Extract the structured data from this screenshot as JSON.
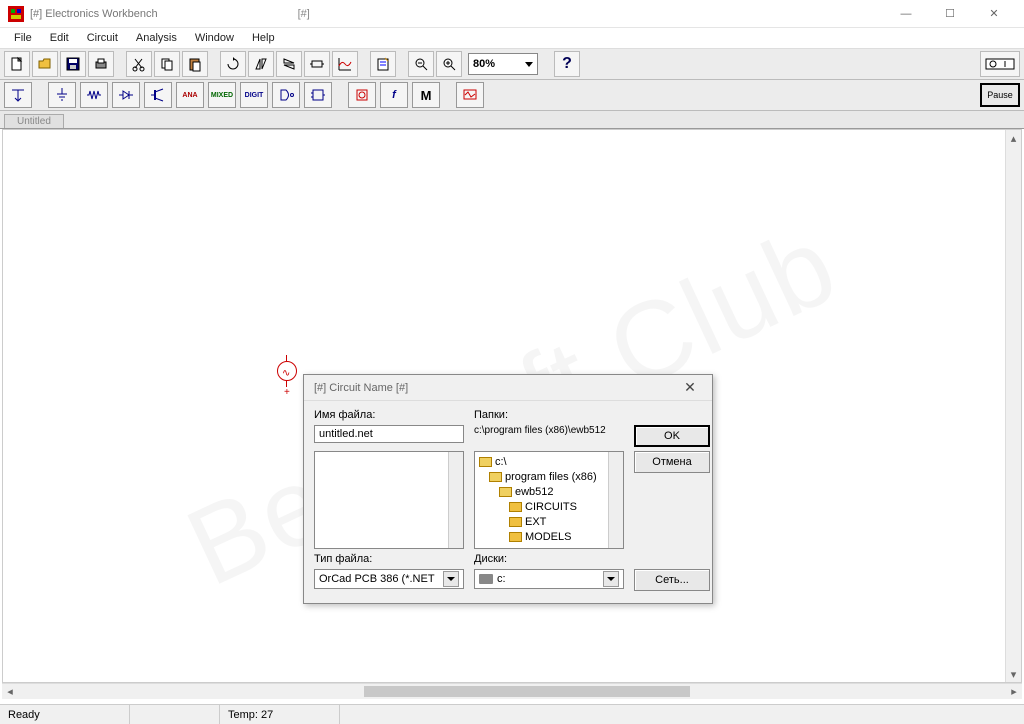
{
  "window": {
    "title": "[#] Electronics Workbench",
    "doc_marker": "[#]",
    "min": "—",
    "max": "☐",
    "close": "✕"
  },
  "menu": {
    "file": "File",
    "edit": "Edit",
    "circuit": "Circuit",
    "analysis": "Analysis",
    "window": "Window",
    "help": "Help"
  },
  "zoom": "80%",
  "pause": "Pause",
  "tab": "Untitled",
  "comp_labels": {
    "ana": "ANA",
    "mixed": "MIXED",
    "digit": "DIGIT",
    "f": "f",
    "m": "M"
  },
  "dialog": {
    "title": "[#] Circuit Name [#]",
    "filename_label": "Имя файла:",
    "filename_value": "untitled.net",
    "folders_label": "Папки:",
    "current_path": "c:\\program files (x86)\\ewb512",
    "ok": "OK",
    "cancel": "Отмена",
    "type_label": "Тип файла:",
    "type_value": "OrCad PCB 386 (*.NET",
    "disks_label": "Диски:",
    "disks_value": "c:",
    "network": "Сеть...",
    "tree": {
      "root": "c:\\",
      "n1": "program files (x86)",
      "n2": "ewb512",
      "n3": "CIRCUITS",
      "n4": "EXT",
      "n5": "MODELS"
    }
  },
  "status": {
    "ready": "Ready",
    "temp": "Temp:  27"
  }
}
